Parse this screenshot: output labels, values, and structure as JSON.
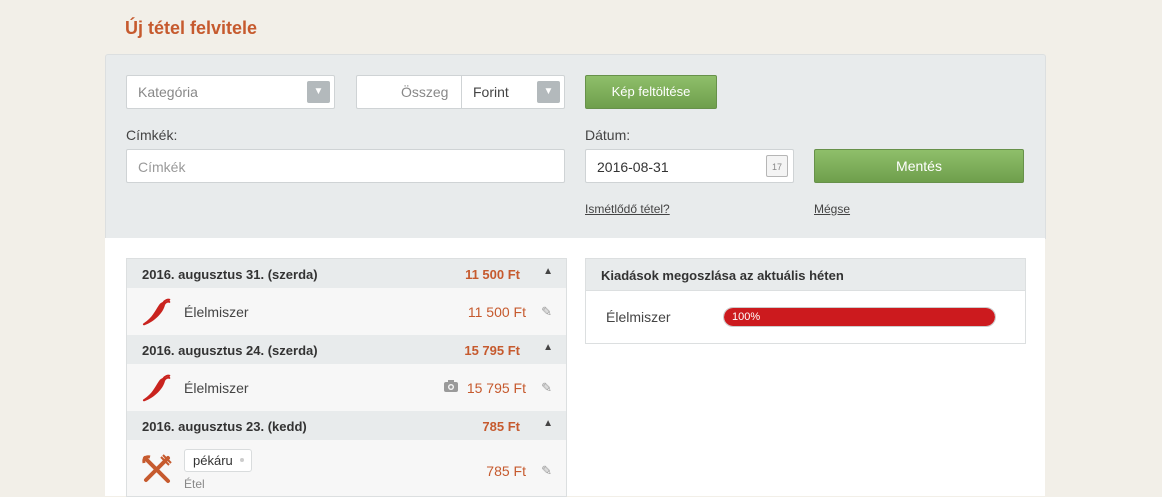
{
  "page_title": "Új tétel felvitele",
  "form": {
    "category_placeholder": "Kategória",
    "amount_placeholder": "Összeg",
    "currency_value": "Forint",
    "upload_button": "Kép feltöltése",
    "tags_label": "Címkék:",
    "tags_placeholder": "Címkék",
    "date_label": "Dátum:",
    "date_value": "2016-08-31",
    "save_button": "Mentés",
    "recurring_link": "Ismétlődő tétel?",
    "cancel_link": "Mégse"
  },
  "days": [
    {
      "date": "2016. augusztus 31. (szerda)",
      "total": "11 500 Ft",
      "items": [
        {
          "category": "Élelmiszer",
          "amount": "11 500 Ft",
          "icon": "chili-pepper-icon"
        }
      ]
    },
    {
      "date": "2016. augusztus 24. (szerda)",
      "total": "15 795 Ft",
      "items": [
        {
          "category": "Élelmiszer",
          "amount": "15 795 Ft",
          "icon": "chili-pepper-icon",
          "has_photo": true
        }
      ]
    },
    {
      "date": "2016. augusztus 23. (kedd)",
      "total": "785 Ft",
      "items": [
        {
          "tag": "pékáru",
          "category": "Étel",
          "amount": "785 Ft",
          "icon": "fork-knife-icon"
        }
      ]
    }
  ],
  "stats": {
    "title": "Kiadások megoszlása az aktuális héten",
    "rows": [
      {
        "name": "Élelmiszer",
        "percent_label": "100%",
        "percent": 100
      }
    ]
  },
  "colors": {
    "accent": "#c65a2e",
    "green": "#7aab57",
    "bar": "#cc1a1e"
  }
}
